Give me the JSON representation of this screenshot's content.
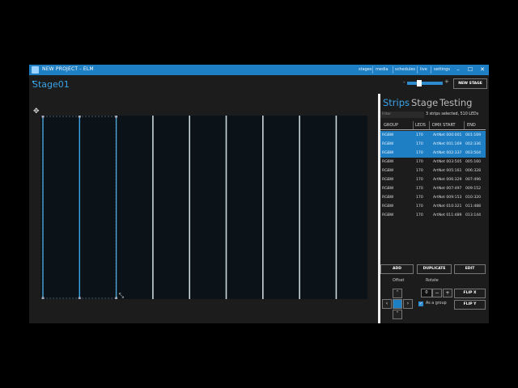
{
  "window": {
    "title": "NEW PROJECT - ELM",
    "nav": [
      "stages",
      "media",
      "schedules",
      "live",
      "settings"
    ],
    "controls": {
      "minimize": "–",
      "maximize": "☐",
      "close": "✕"
    }
  },
  "stage": {
    "name": "Stage01",
    "zoom": {
      "minus": "-",
      "plus": "+",
      "level": 0.28
    },
    "new_stage_label": "NEW STAGE",
    "strip_count": 9,
    "selected_strips": 3
  },
  "panel": {
    "tabs": [
      {
        "label": "Strips",
        "active": true
      },
      {
        "label": "Stage",
        "active": false
      },
      {
        "label": "Testing",
        "active": false
      }
    ],
    "filter_placeholder": "Filter",
    "selection_info": "3 strips selected, 510 LEDs",
    "columns": [
      "GROUP",
      "LEDS",
      "DMX START",
      "END"
    ],
    "rows": [
      {
        "group": "RGBW",
        "leds": "170",
        "dmx_start": "ArtNet 000:001",
        "end": "001:169",
        "selected": true
      },
      {
        "group": "RGBW",
        "leds": "170",
        "dmx_start": "ArtNet 001:169",
        "end": "002:336",
        "selected": true
      },
      {
        "group": "RGBW",
        "leds": "170",
        "dmx_start": "ArtNet 002:337",
        "end": "003:504",
        "selected": true
      },
      {
        "group": "RGBW",
        "leds": "170",
        "dmx_start": "ArtNet 003:505",
        "end": "005:160",
        "selected": false
      },
      {
        "group": "RGBW",
        "leds": "170",
        "dmx_start": "ArtNet 005:161",
        "end": "006:328",
        "selected": false
      },
      {
        "group": "RGBW",
        "leds": "170",
        "dmx_start": "ArtNet 006:329",
        "end": "007:496",
        "selected": false
      },
      {
        "group": "RGBW",
        "leds": "170",
        "dmx_start": "ArtNet 007:497",
        "end": "009:152",
        "selected": false
      },
      {
        "group": "RGBW",
        "leds": "170",
        "dmx_start": "ArtNet 009:153",
        "end": "010:320",
        "selected": false
      },
      {
        "group": "RGBW",
        "leds": "170",
        "dmx_start": "ArtNet 010:321",
        "end": "011:488",
        "selected": false
      },
      {
        "group": "RGBW",
        "leds": "170",
        "dmx_start": "ArtNet 011:489",
        "end": "013:144",
        "selected": false
      }
    ],
    "buttons": {
      "add": "ADD",
      "duplicate": "DUPLICATE",
      "edit": "EDIT"
    },
    "offset_label": "Offset",
    "rotate_label": "Rotate",
    "rotate_value": "0",
    "rotate_minus": "−",
    "rotate_plus": "+",
    "as_group_label": "As a group",
    "as_group_checked": true,
    "flip_x": "FLIP X",
    "flip_y": "FLIP Y",
    "arrows": {
      "up": "˄",
      "down": "˅",
      "left": "‹",
      "right": "›"
    }
  },
  "colors": {
    "accent": "#1e7fc4",
    "selection": "#3aa3e8",
    "strip": "#c8d6dc",
    "canvas": "#0b1319",
    "background": "#1c1c1c"
  }
}
